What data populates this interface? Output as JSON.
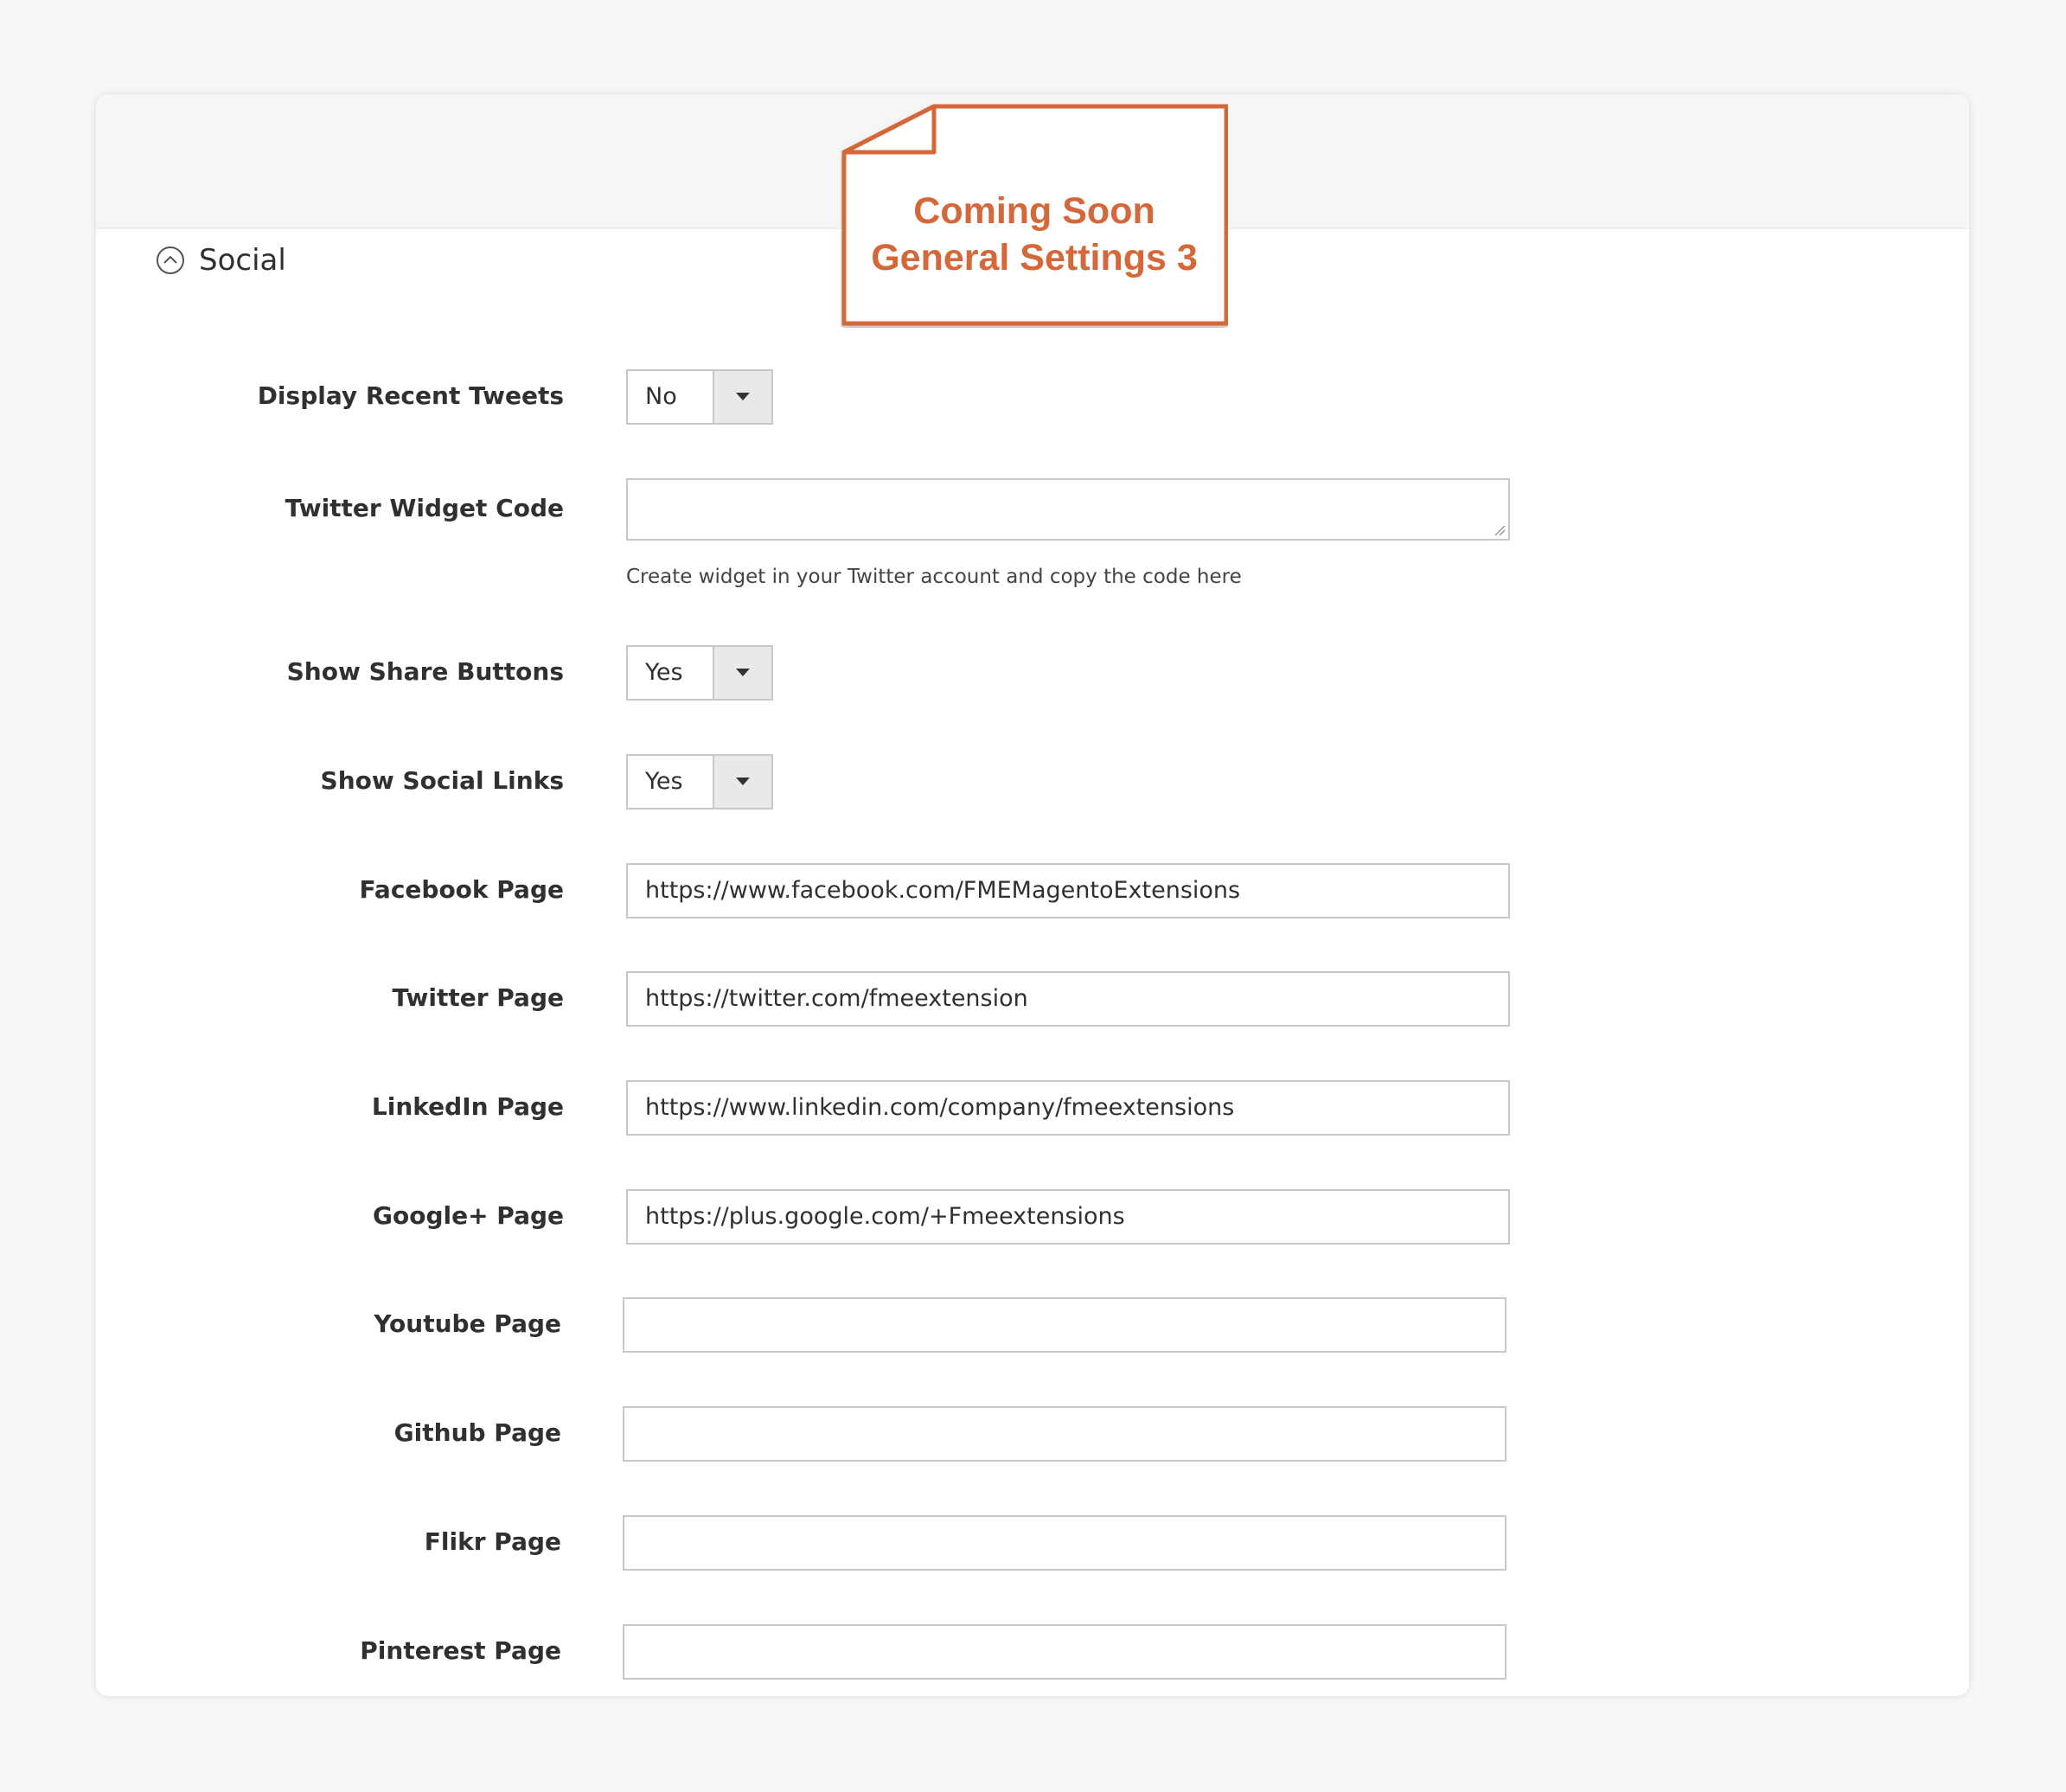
{
  "note": {
    "line1": "Coming Soon",
    "line2": "General Settings 3",
    "color": "#d4683a"
  },
  "section": {
    "title": "Social",
    "icon": "collapse-circle-icon"
  },
  "fields": {
    "display_recent_tweets": {
      "label": "Display Recent Tweets",
      "value": "No"
    },
    "twitter_widget_code": {
      "label": "Twitter Widget Code",
      "value": "",
      "hint": "Create widget in your Twitter account and copy the code here"
    },
    "show_share_buttons": {
      "label": "Show Share Buttons",
      "value": "Yes"
    },
    "show_social_links": {
      "label": "Show Social Links",
      "value": "Yes"
    },
    "facebook_page": {
      "label": "Facebook Page",
      "value": "https://www.facebook.com/FMEMagentoExtensions"
    },
    "twitter_page": {
      "label": "Twitter Page",
      "value": "https://twitter.com/fmeextension"
    },
    "linkedin_page": {
      "label": "LinkedIn Page",
      "value": "https://www.linkedin.com/company/fmeextensions"
    },
    "googleplus_page": {
      "label": "Google+ Page",
      "value": "https://plus.google.com/+Fmeextensions"
    },
    "youtube_page": {
      "label": "Youtube Page",
      "value": ""
    },
    "github_page": {
      "label": "Github Page",
      "value": ""
    },
    "flikr_page": {
      "label": "Flikr Page",
      "value": ""
    },
    "pinterest_page": {
      "label": "Pinterest Page",
      "value": ""
    }
  }
}
